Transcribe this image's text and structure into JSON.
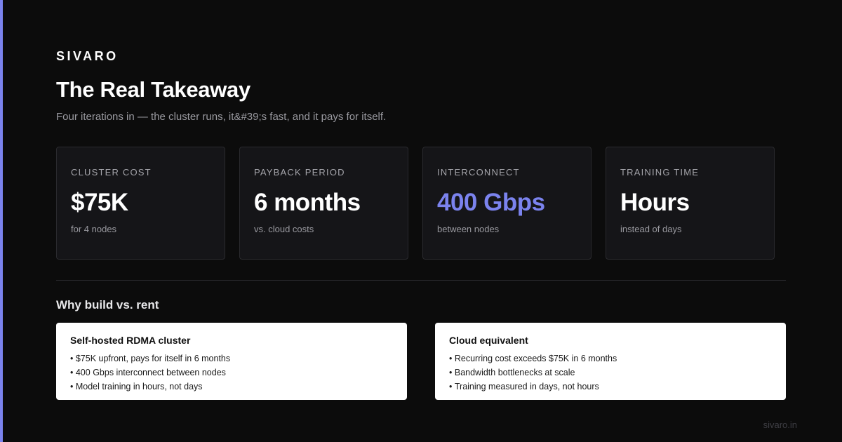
{
  "brand": "SIVARO",
  "title": "The Real Takeaway",
  "subtitle": "Four iterations in — the cluster runs, it&#39;s fast, and it pays for itself.",
  "accent_color": "#7b83ee",
  "stats": [
    {
      "label": "CLUSTER COST",
      "value": "$75K",
      "note": "for 4 nodes"
    },
    {
      "label": "PAYBACK PERIOD",
      "value": "6 months",
      "note": "vs. cloud costs"
    },
    {
      "label": "INTERCONNECT",
      "value": "400 Gbps",
      "note": "between nodes"
    },
    {
      "label": "TRAINING TIME",
      "value": "Hours",
      "note": "instead of days"
    }
  ],
  "section_heading": "Why build vs. rent",
  "comparison": [
    {
      "title": "Self-hosted RDMA cluster",
      "items": [
        "$75K upfront, pays for itself in 6 months",
        "400 Gbps interconnect between nodes",
        "Model training in hours, not days"
      ]
    },
    {
      "title": "Cloud equivalent",
      "items": [
        "Recurring cost exceeds $75K in 6 months",
        "Bandwidth bottlenecks at scale",
        "Training measured in days, not hours"
      ]
    }
  ],
  "footer": "sivaro.in"
}
